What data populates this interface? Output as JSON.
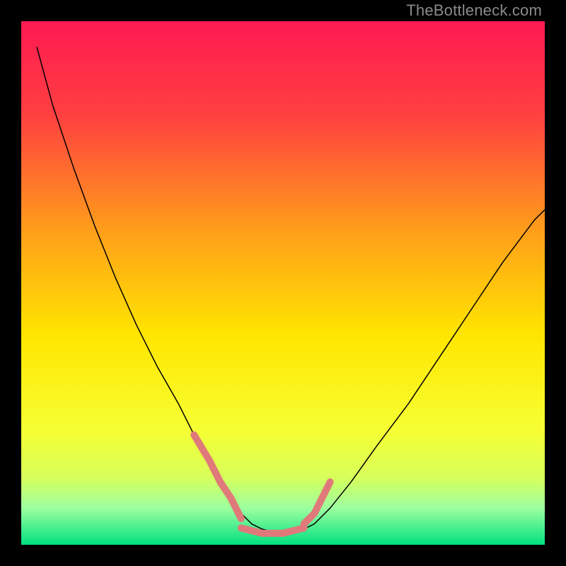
{
  "watermark": "TheBottleneck.com",
  "chart_data": {
    "type": "line",
    "title": "",
    "xlabel": "",
    "ylabel": "",
    "xlim": [
      0,
      100
    ],
    "ylim": [
      0,
      100
    ],
    "legend": false,
    "grid": false,
    "background_gradient": {
      "stops": [
        {
          "pos": 0.0,
          "color": "#ff1a52"
        },
        {
          "pos": 0.18,
          "color": "#ff4040"
        },
        {
          "pos": 0.4,
          "color": "#ff9e1a"
        },
        {
          "pos": 0.6,
          "color": "#ffe600"
        },
        {
          "pos": 0.78,
          "color": "#f6ff33"
        },
        {
          "pos": 0.87,
          "color": "#d8ff5a"
        },
        {
          "pos": 0.93,
          "color": "#9dffa0"
        },
        {
          "pos": 1.0,
          "color": "#00e080"
        }
      ]
    },
    "series": [
      {
        "name": "curve-main",
        "color": "#000000",
        "thick": 1.5,
        "x": [
          3,
          6,
          10,
          14,
          18,
          22,
          26,
          30,
          33,
          36,
          38,
          40,
          42,
          44,
          46,
          50,
          54,
          56,
          59,
          63,
          68,
          74,
          80,
          86,
          92,
          98,
          100
        ],
        "y": [
          95,
          84,
          72,
          61,
          51,
          42,
          34,
          27,
          21,
          16,
          12,
          9,
          6,
          4,
          3,
          2,
          3,
          4,
          7,
          12,
          19,
          27,
          36,
          45,
          54,
          62,
          64
        ]
      },
      {
        "name": "highlight-left",
        "color": "#e07a7a",
        "thick": 10,
        "x": [
          33,
          36,
          38,
          40,
          42
        ],
        "y": [
          21,
          16,
          12,
          9,
          5
        ]
      },
      {
        "name": "highlight-right",
        "color": "#e07a7a",
        "thick": 10,
        "x": [
          54,
          56,
          59
        ],
        "y": [
          4,
          6,
          12
        ]
      },
      {
        "name": "highlight-bottom",
        "color": "#e07a7a",
        "thick": 10,
        "x": [
          42,
          46,
          50,
          54
        ],
        "y": [
          3.2,
          2.2,
          2.2,
          3.2
        ]
      }
    ]
  }
}
